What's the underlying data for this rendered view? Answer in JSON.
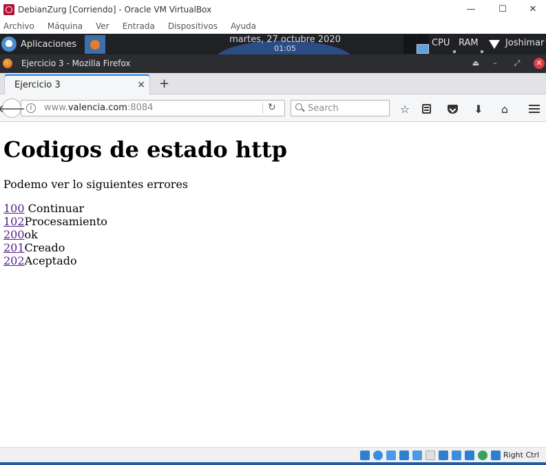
{
  "vbox": {
    "window_title": "DebianZurg [Corriendo] - Oracle VM VirtualBox",
    "controls": {
      "minimize": "—",
      "maximize": "☐",
      "close": "✕"
    },
    "menu": [
      "Archivo",
      "Máquina",
      "Ver",
      "Entrada",
      "Dispositivos",
      "Ayuda"
    ],
    "status_icons": [
      "hard-disk-icon",
      "optical-disc-icon",
      "audio-icon",
      "network-icon",
      "usb-icon",
      "shared-folders-icon",
      "display-icon",
      "video-capture-icon",
      "cpu-icon",
      "mouse-integration-icon",
      "keyboard-icon"
    ],
    "host_key": "Right Ctrl"
  },
  "panel": {
    "apps_label": "Aplicaciones",
    "clock_date": "martes, 27 octubre 2020",
    "clock_time": "01:05",
    "cpu_label": "CPU",
    "ram_label": "RAM",
    "user_label": "Joshimar"
  },
  "firefox": {
    "window_title": "Ejercicio 3 - Mozilla Firefox",
    "window_controls": {
      "eject": "⏏",
      "minimize": "–",
      "maximize": "⤢",
      "close": "✕"
    },
    "tab_label": "Ejercicio 3",
    "tab_close": "×",
    "new_tab": "+",
    "url": {
      "scheme": "www.",
      "host": "valencia.com",
      "port": ":8084"
    },
    "search_placeholder": "Search",
    "nav_glyphs": {
      "back": "🡐",
      "info": "i",
      "reload": "↻",
      "bookmark": "☆",
      "downloads": "⬇",
      "home": "⌂"
    }
  },
  "page": {
    "heading": "Codigos de estado http",
    "intro": "Podemo ver lo siguientes errores",
    "status_codes": [
      {
        "code": "100",
        "text": " Continuar"
      },
      {
        "code": "102",
        "text": "Procesamiento"
      },
      {
        "code": "200",
        "text": "ok"
      },
      {
        "code": "201",
        "text": "Creado"
      },
      {
        "code": "202",
        "text": "Aceptado"
      }
    ]
  },
  "colors": {
    "link": "#551a8b",
    "panel_bg": "#1f2124",
    "firefox_titlebar": "#2b2d31",
    "tab_accent": "#0a84ff",
    "vbox_accent": "#1f5ca8"
  }
}
